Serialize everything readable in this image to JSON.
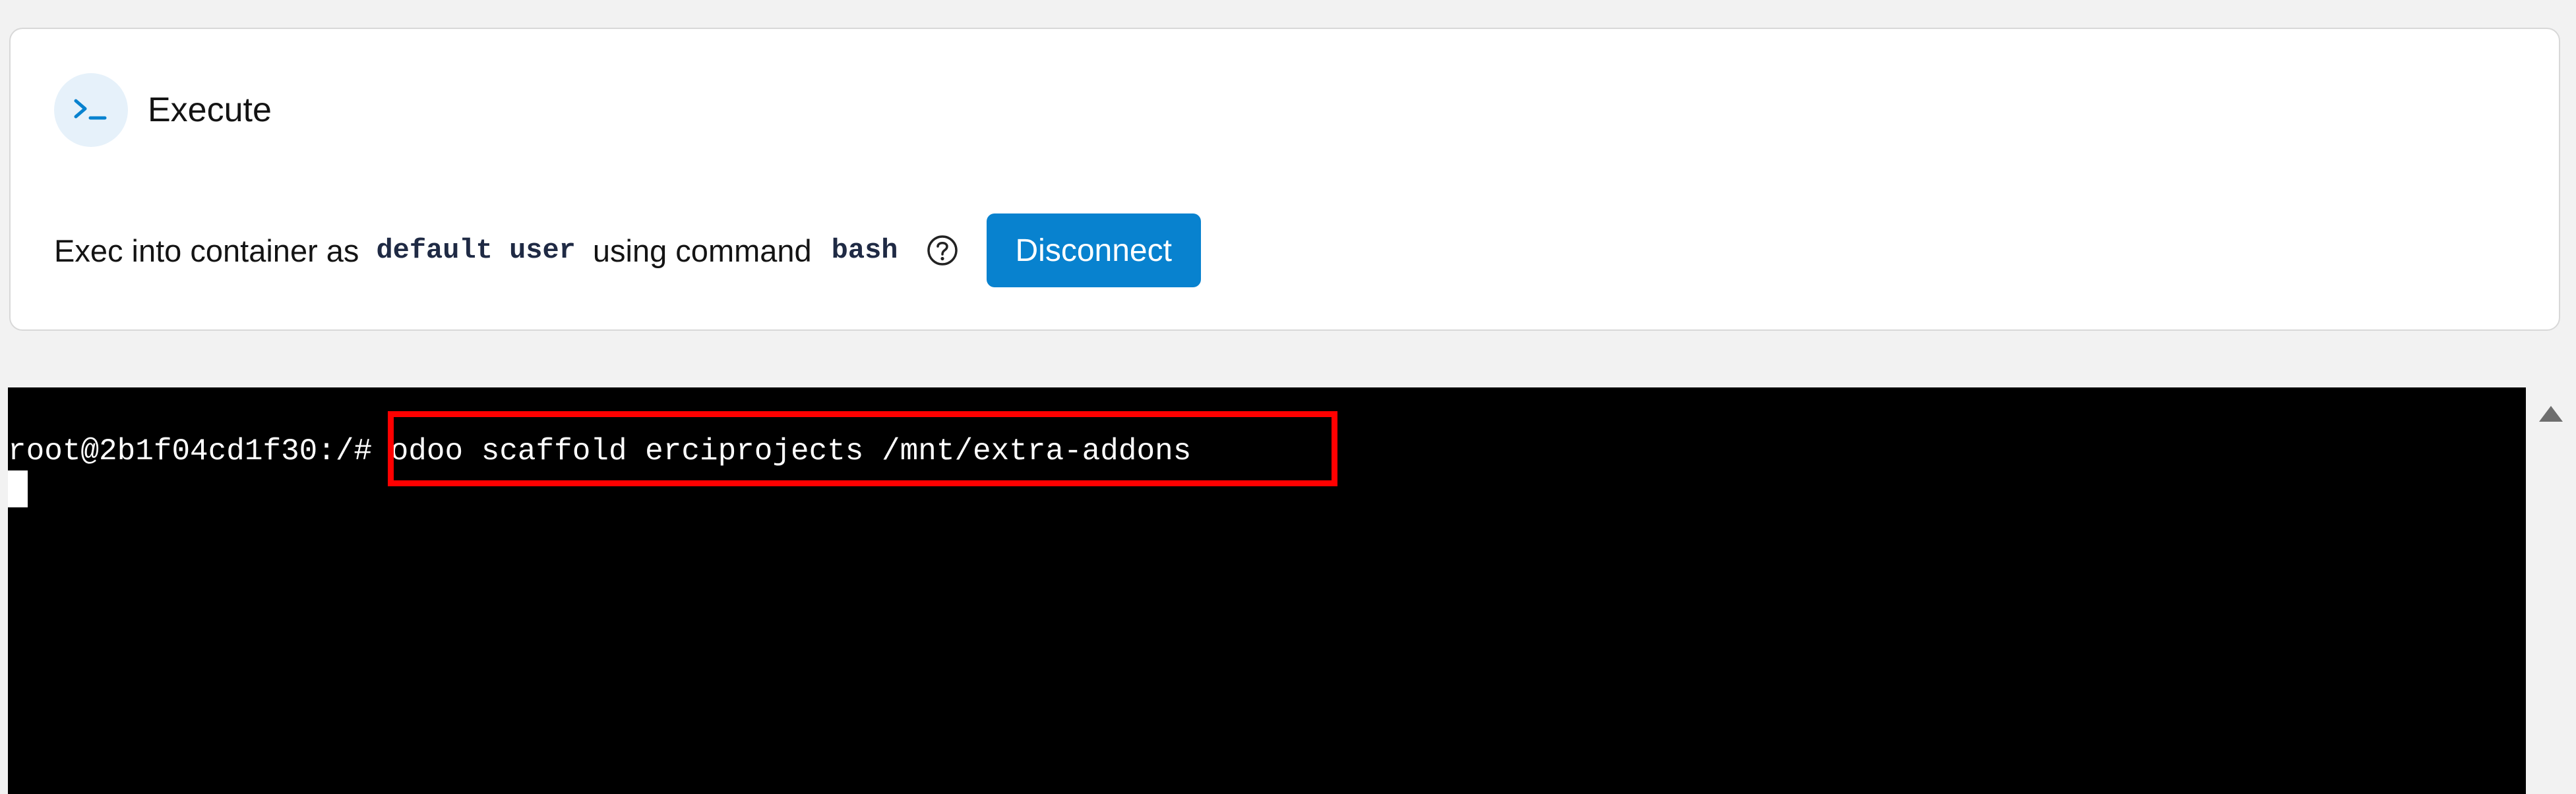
{
  "execute_panel": {
    "title": "Execute",
    "icon": "terminal-prompt-icon",
    "description_prefix": "Exec into container as",
    "user": "default user",
    "description_middle": "using command",
    "command": "bash",
    "help_icon": "question-circle-icon",
    "disconnect_label": "Disconnect"
  },
  "terminal": {
    "prompt": "root@2b1f04cd1f30:/#",
    "command": " odoo scaffold erciprojects /mnt/extra-addons",
    "highlight_color": "#ff0000"
  },
  "colors": {
    "accent": "#0882cf",
    "icon_bg": "#e6f1fa",
    "terminal_bg": "#000000",
    "page_bg": "#f2f2f2"
  }
}
